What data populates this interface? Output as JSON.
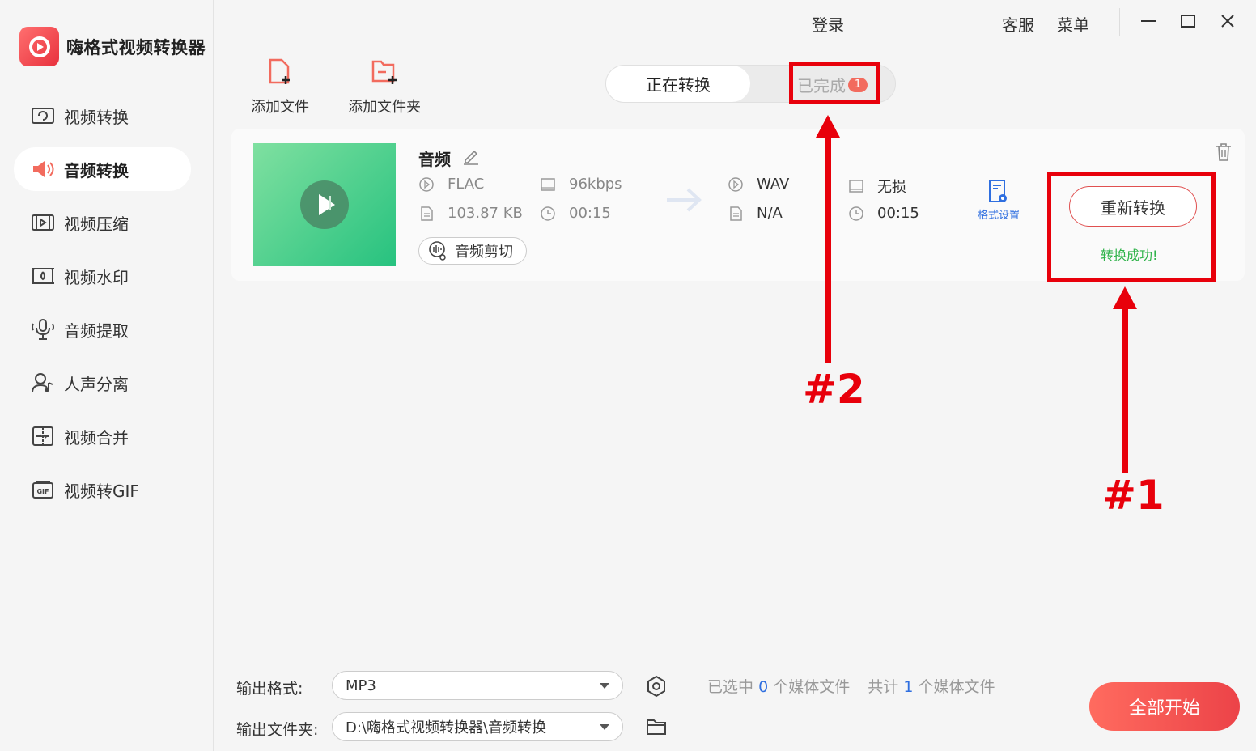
{
  "app": {
    "name": "嗨格式视频转换器"
  },
  "topbar": {
    "login": "登录",
    "service": "客服",
    "menu": "菜单"
  },
  "sidebar": {
    "items": [
      {
        "label": "视频转换",
        "icon": "video-convert-icon",
        "active": false
      },
      {
        "label": "音频转换",
        "icon": "audio-convert-icon",
        "active": true
      },
      {
        "label": "视频压缩",
        "icon": "video-compress-icon",
        "active": false
      },
      {
        "label": "视频水印",
        "icon": "video-watermark-icon",
        "active": false
      },
      {
        "label": "音频提取",
        "icon": "audio-extract-icon",
        "active": false
      },
      {
        "label": "人声分离",
        "icon": "vocal-separate-icon",
        "active": false
      },
      {
        "label": "视频合并",
        "icon": "video-merge-icon",
        "active": false
      },
      {
        "label": "视频转GIF",
        "icon": "video-gif-icon",
        "active": false
      }
    ]
  },
  "toolbar": {
    "add_file": "添加文件",
    "add_folder": "添加文件夹"
  },
  "tabs": {
    "converting": "正在转换",
    "done": "已完成",
    "done_count": "1"
  },
  "file": {
    "title": "音频",
    "src_format": "FLAC",
    "src_bitrate": "96kbps",
    "src_size": "103.87 KB",
    "src_duration": "00:15",
    "dst_format": "WAV",
    "dst_quality": "无损",
    "dst_size": "N/A",
    "dst_duration": "00:15",
    "cut_label": "音频剪切",
    "format_settings": "格式设置",
    "reconvert": "重新转换",
    "status": "转换成功!"
  },
  "annotations": {
    "label1": "#1",
    "label2": "#2"
  },
  "bottom": {
    "format_label": "输出格式:",
    "format_value": "MP3",
    "folder_label": "输出文件夹:",
    "folder_value": "D:\\嗨格式视频转换器\\音频转换",
    "selected_prefix": "已选中",
    "selected_count": "0",
    "selected_suffix": "个媒体文件",
    "total_prefix": "共计",
    "total_count": "1",
    "total_suffix": "个媒体文件",
    "start_all": "全部开始"
  },
  "colors": {
    "accent": "#ec4348",
    "annotation": "#e8000b",
    "link": "#2f6fe0",
    "success": "#2fb34a"
  }
}
